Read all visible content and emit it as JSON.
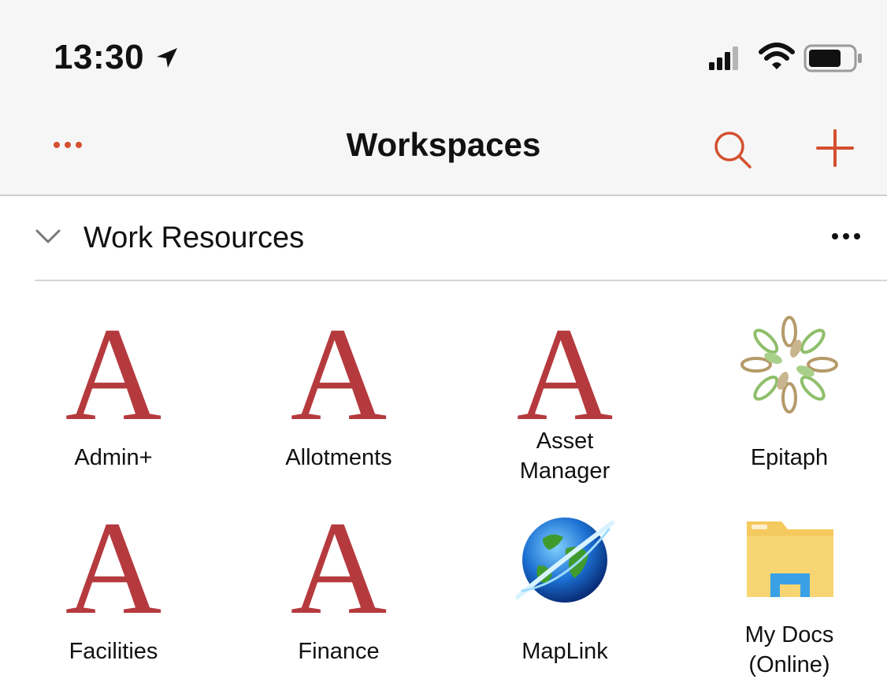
{
  "status": {
    "time": "13:30",
    "location_icon": "location-arrow-icon",
    "signal_icon": "cellular-signal-icon",
    "wifi_icon": "wifi-icon",
    "battery_icon": "battery-icon"
  },
  "nav": {
    "title": "Workspaces",
    "more_icon": "ellipsis-icon",
    "search_icon": "search-icon",
    "add_icon": "plus-icon",
    "accent": "#d4502f"
  },
  "section": {
    "title": "Work Resources",
    "collapse_icon": "chevron-down-icon",
    "more_icon": "ellipsis-icon"
  },
  "apps": [
    {
      "label": "Admin+",
      "icon": "letter-a-icon",
      "glyph": "A"
    },
    {
      "label": "Allotments",
      "icon": "letter-a-icon",
      "glyph": "A"
    },
    {
      "label_line1": "Asset",
      "label_line2": "Manager",
      "icon": "letter-a-icon",
      "glyph": "A"
    },
    {
      "label": "Epitaph",
      "icon": "leaf-wreath-icon"
    },
    {
      "label": "Facilities",
      "icon": "letter-a-icon",
      "glyph": "A"
    },
    {
      "label": "Finance",
      "icon": "letter-a-icon",
      "glyph": "A"
    },
    {
      "label": "MapLink",
      "icon": "globe-icon"
    },
    {
      "label_line1": "My Docs",
      "label_line2": "(Online)",
      "icon": "folder-icon"
    }
  ]
}
